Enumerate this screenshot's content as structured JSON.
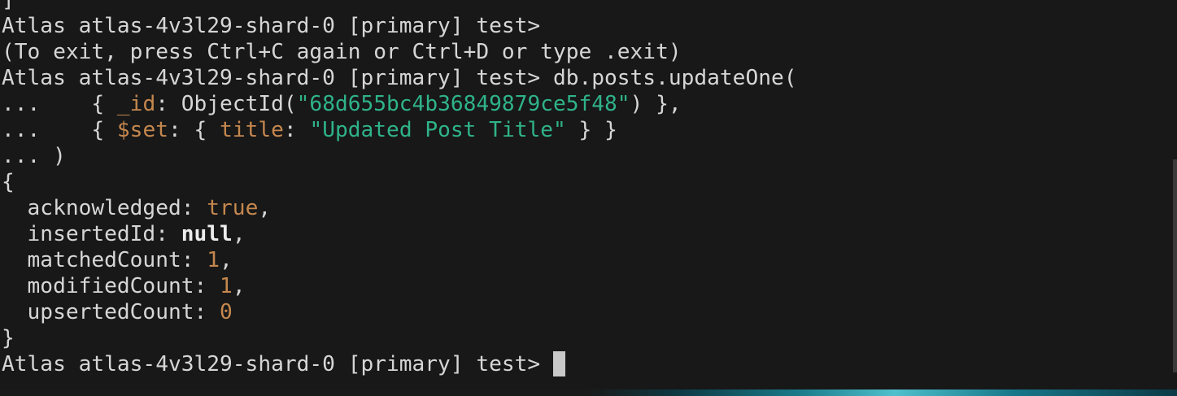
{
  "colors": {
    "background": "#181818",
    "text": "#d6d6d6",
    "string": "#2fb389",
    "literal": "#c4874e"
  },
  "terminal": {
    "lines": [
      [
        {
          "text": "]",
          "style": "plain"
        }
      ],
      [
        {
          "text": "Atlas atlas-4v3l29-shard-0 [primary] test>",
          "style": "plain"
        }
      ],
      [
        {
          "text": "(To exit, press Ctrl+C again or Ctrl+D or type .exit)",
          "style": "plain"
        }
      ],
      [
        {
          "text": "Atlas atlas-4v3l29-shard-0 [primary] test> db.posts.updateOne(",
          "style": "plain"
        }
      ],
      [
        {
          "text": "...    { ",
          "style": "plain"
        },
        {
          "text": "_id",
          "style": "key"
        },
        {
          "text": ": ObjectId(",
          "style": "plain"
        },
        {
          "text": "\"68d655bc4b36849879ce5f48\"",
          "style": "string"
        },
        {
          "text": ") },",
          "style": "plain"
        }
      ],
      [
        {
          "text": "...    { ",
          "style": "plain"
        },
        {
          "text": "$set",
          "style": "key"
        },
        {
          "text": ": { ",
          "style": "plain"
        },
        {
          "text": "title",
          "style": "key"
        },
        {
          "text": ": ",
          "style": "plain"
        },
        {
          "text": "\"Updated Post Title\"",
          "style": "string"
        },
        {
          "text": " } }",
          "style": "plain"
        }
      ],
      [
        {
          "text": "... )",
          "style": "plain"
        }
      ],
      [
        {
          "text": "{",
          "style": "plain"
        }
      ],
      [
        {
          "text": "  acknowledged: ",
          "style": "plain"
        },
        {
          "text": "true",
          "style": "literal"
        },
        {
          "text": ",",
          "style": "plain"
        }
      ],
      [
        {
          "text": "  insertedId: ",
          "style": "plain"
        },
        {
          "text": "null",
          "style": "bold"
        },
        {
          "text": ",",
          "style": "plain"
        }
      ],
      [
        {
          "text": "  matchedCount: ",
          "style": "plain"
        },
        {
          "text": "1",
          "style": "literal"
        },
        {
          "text": ",",
          "style": "plain"
        }
      ],
      [
        {
          "text": "  modifiedCount: ",
          "style": "plain"
        },
        {
          "text": "1",
          "style": "literal"
        },
        {
          "text": ",",
          "style": "plain"
        }
      ],
      [
        {
          "text": "  upsertedCount: ",
          "style": "plain"
        },
        {
          "text": "0",
          "style": "literal"
        }
      ],
      [
        {
          "text": "}",
          "style": "plain"
        }
      ],
      [
        {
          "text": "Atlas atlas-4v3l29-shard-0 [primary] test> ",
          "style": "plain"
        }
      ]
    ]
  }
}
